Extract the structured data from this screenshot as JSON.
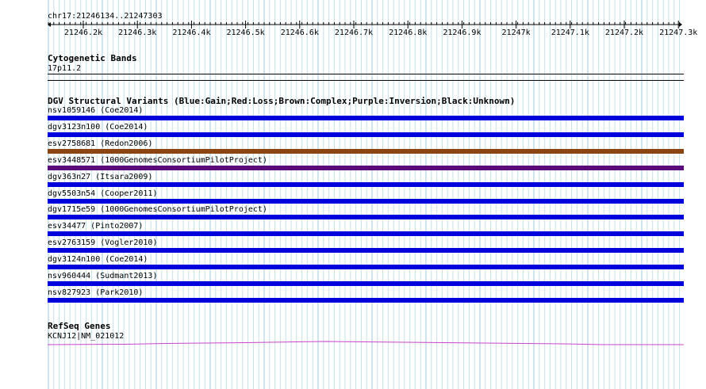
{
  "ruler": {
    "locus": "chr17:21246134..21247303",
    "ticks": [
      "21246.2k",
      "21246.3k",
      "21246.4k",
      "21246.5k",
      "21246.6k",
      "21246.7k",
      "21246.8k",
      "21246.9k",
      "21247k",
      "21247.1k",
      "21247.2k",
      "21247.3k"
    ]
  },
  "cytoband": {
    "title": "Cytogenetic Bands",
    "band": "17p11.2"
  },
  "dgv": {
    "title": "DGV Structural Variants (Blue:Gain;Red:Loss;Brown:Complex;Purple:Inversion;Black:Unknown)",
    "colors": {
      "gain": "#0000dd",
      "loss": "#dd0000",
      "complex": "#8b4513",
      "inversion": "#5a0a7a",
      "unknown": "#000000"
    },
    "variants": [
      {
        "label": "nsv1059146 (Coe2014)",
        "type": "gain"
      },
      {
        "label": "dgv3123n100 (Coe2014)",
        "type": "gain"
      },
      {
        "label": "esv2758681 (Redon2006)",
        "type": "complex"
      },
      {
        "label": "esv3448571 (1000GenomesConsortiumPilotProject)",
        "type": "inversion"
      },
      {
        "label": "dgv363n27 (Itsara2009)",
        "type": "gain"
      },
      {
        "label": "dgv5503n54 (Cooper2011)",
        "type": "gain"
      },
      {
        "label": "dgv1715e59 (1000GenomesConsortiumPilotProject)",
        "type": "gain"
      },
      {
        "label": "esv34477 (Pinto2007)",
        "type": "gain"
      },
      {
        "label": "esv2763159 (Vogler2010)",
        "type": "gain"
      },
      {
        "label": "dgv3124n100 (Coe2014)",
        "type": "gain"
      },
      {
        "label": "nsv960444 (Sudmant2013)",
        "type": "gain"
      },
      {
        "label": "nsv827923 (Park2010)",
        "type": "gain"
      }
    ]
  },
  "refseq": {
    "title": "RefSeq Genes",
    "gene": "KCNJ12|NM_021012",
    "color": "#cc44cc"
  }
}
